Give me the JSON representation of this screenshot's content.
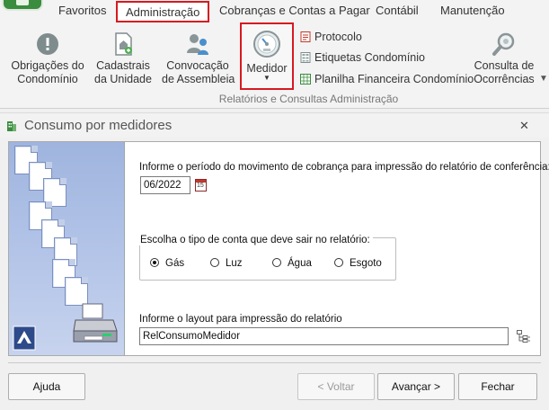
{
  "ribbon": {
    "tabs": [
      "Favoritos",
      "Administração",
      "Cobranças e Contas a Pagar",
      "Contábil",
      "Manutenção"
    ],
    "active_tab": "Administração",
    "buttons": {
      "obrigacoes": [
        "Obrigações do",
        "Condomínio"
      ],
      "cadastrais": [
        "Cadastrais",
        "da Unidade"
      ],
      "convocacao": [
        "Convocação",
        "de Assembleia"
      ],
      "medidor": "Medidor",
      "consulta": [
        "Consulta de",
        "Ocorrências"
      ]
    },
    "small_commands": [
      "Protocolo",
      "Etiquetas Condomínio",
      "Planilha Financeira Condomínio"
    ],
    "group_caption": "Relatórios e Consultas Administração"
  },
  "dialog": {
    "title": "Consumo por medidores",
    "period_label": "Informe o período do movimento de cobrança para impressão do relatório de conferência:",
    "period_value": "06/2022",
    "calendar_icon_text": "15",
    "account_type_legend": "Escolha o tipo de conta que deve sair no relatório:",
    "account_types": [
      "Gás",
      "Luz",
      "Água",
      "Esgoto"
    ],
    "selected_account_type": "Gás",
    "layout_label": "Informe o layout para impressão do relatório",
    "layout_value": "RelConsumoMedidor",
    "buttons": {
      "help": "Ajuda",
      "back": "< Voltar",
      "next": "Avançar >",
      "close": "Fechar"
    }
  },
  "colors": {
    "highlight_border": "#d71920",
    "art_panel": "#a9bce3",
    "brand_green": "#3a8c3f"
  }
}
